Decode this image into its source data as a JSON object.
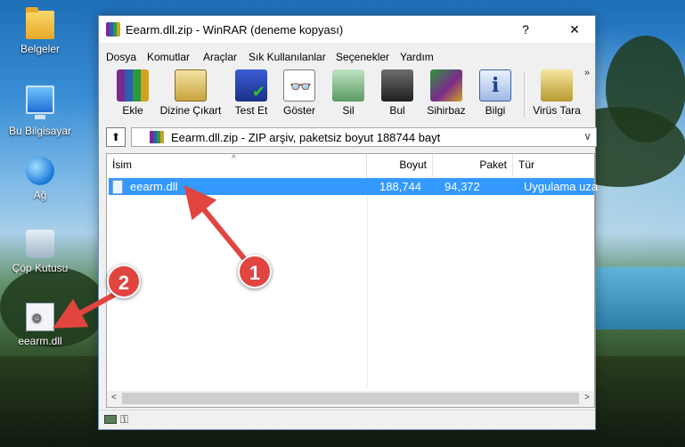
{
  "desktop": {
    "icons": [
      {
        "label": "Belgeler",
        "icon": "folder-icon"
      },
      {
        "label": "Bu Bilgisayar",
        "icon": "computer-icon"
      },
      {
        "label": "Ağ",
        "icon": "network-icon"
      },
      {
        "label": "Çöp Kutusu",
        "icon": "recycle-bin-icon"
      },
      {
        "label": "eearm.dll",
        "icon": "dll-file-icon"
      }
    ]
  },
  "window": {
    "title": "Eearm.dll.zip - WinRAR (deneme kopyası)",
    "help_glyph": "?",
    "minimize_glyph": "—",
    "maximize_glyph": "☐",
    "close_glyph": "✕"
  },
  "menu": [
    "Dosya",
    "Komutlar",
    "Araçlar",
    "Sık Kullanılanlar",
    "Seçenekler",
    "Yardım"
  ],
  "toolbar": {
    "buttons": [
      {
        "label": "Ekle"
      },
      {
        "label": "Dizine Çıkart"
      },
      {
        "label": "Test Et"
      },
      {
        "label": "Göster"
      },
      {
        "label": "Sil"
      },
      {
        "label": "Bul"
      },
      {
        "label": "Sihirbaz"
      },
      {
        "label": "Bilgi"
      },
      {
        "label": "Virüs Tara"
      }
    ],
    "more_glyph": "»"
  },
  "pathbar": {
    "up_glyph": "⬆",
    "text": "Eearm.dll.zip - ZIP arşiv, paketsiz boyut 188744 bayt",
    "dropdown_glyph": "∨"
  },
  "filelist": {
    "columns": [
      "İsim",
      "Boyut",
      "Paket",
      "Tür"
    ],
    "rows": [
      {
        "name": "eearm.dll",
        "size": "188,744",
        "packed": "94,372",
        "type": "Uygulama uza"
      }
    ],
    "scroll_left": "<",
    "scroll_right": ">"
  },
  "annotations": {
    "badge1": "1",
    "badge2": "2",
    "accent": "#e0453f"
  }
}
